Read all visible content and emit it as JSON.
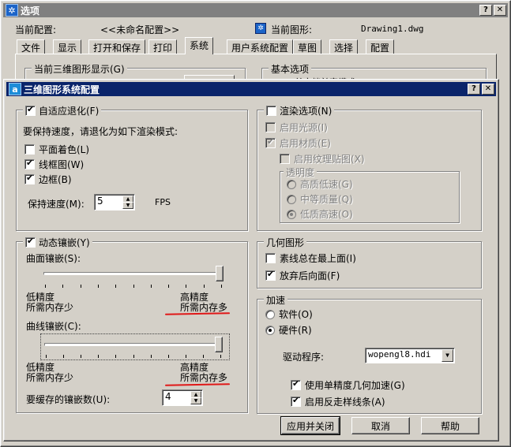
{
  "back_window": {
    "title": "选项",
    "current_profile_label": "当前配置:",
    "current_profile_value": "<<未命名配置>>",
    "current_drawing_label": "当前图形:",
    "current_drawing_value": "Drawing1.dwg",
    "tabs": [
      "文件",
      "显示",
      "打开和保存",
      "打印",
      "系统",
      "用户系统配置",
      "草图",
      "选择",
      "配置"
    ],
    "selected_tab": "系统",
    "group_3d_display": "当前三维图形显示(G)",
    "group_basic": "基本选项",
    "basic_partial": "单文档兼容模式(S)"
  },
  "dialog": {
    "title": "三维图形系统配置",
    "icon": "autocad-a-icon",
    "adaptive": {
      "label": "自适应退化(F)",
      "checked": true,
      "instruction": "要保持速度，请退化为如下渲染模式:",
      "flat_shading": {
        "label": "平面着色(L)",
        "checked": false
      },
      "wireframe": {
        "label": "线框图(W)",
        "checked": true
      },
      "bounding_box": {
        "label": "边框(B)",
        "checked": true
      },
      "maintain_speed_label": "保持速度(M):",
      "maintain_speed_value": "5",
      "fps": "FPS"
    },
    "render_options": {
      "label": "渲染选项(N)",
      "checked": false,
      "enable_lights": {
        "label": "启用光源(I)",
        "checked": false
      },
      "enable_materials": {
        "label": "启用材质(E)",
        "checked": true
      },
      "enable_texture": {
        "label": "启用纹理贴图(X)",
        "checked": false
      },
      "transparency": {
        "label": "透明度",
        "options": [
          "高质低速(G)",
          "中等质量(Q)",
          "低质高速(O)"
        ],
        "selected": 2
      }
    },
    "dynamic_tessellation": {
      "label": "动态镶嵌(Y)",
      "checked": true,
      "surface_label": "曲面镶嵌(S):",
      "surface_low_1": "低精度",
      "surface_low_2": "所需内存少",
      "surface_high_1": "高精度",
      "surface_high_2": "所需内存多",
      "surface_level": 1.0,
      "curve_label": "曲线镶嵌(C):",
      "curve_low_1": "低精度",
      "curve_low_2": "所需内存少",
      "curve_high_1": "高精度",
      "curve_high_2": "所需内存多",
      "curve_level": 1.0,
      "cache_label": "要缓存的镶嵌数(U):",
      "cache_value": "4"
    },
    "geometry": {
      "label": "几何图形",
      "isolines_on_top": {
        "label": "素线总在最上面(I)",
        "checked": false
      },
      "discard_backfaces": {
        "label": "放弃后向面(F)",
        "checked": true
      }
    },
    "acceleration": {
      "label": "加速",
      "software": {
        "label": "软件(O)",
        "selected": false
      },
      "hardware": {
        "label": "硬件(R)",
        "selected": true
      },
      "driver_label": "驱动程序:",
      "driver_value": "wopengl8.hdi",
      "single_precision": {
        "label": "使用单精度几何加速(G)",
        "checked": true
      },
      "antialias": {
        "label": "启用反走样线条(A)",
        "checked": true
      }
    },
    "buttons": {
      "apply_close": "应用并关闭",
      "cancel": "取消",
      "help": "帮助"
    },
    "annotation_color": "#e01818"
  }
}
